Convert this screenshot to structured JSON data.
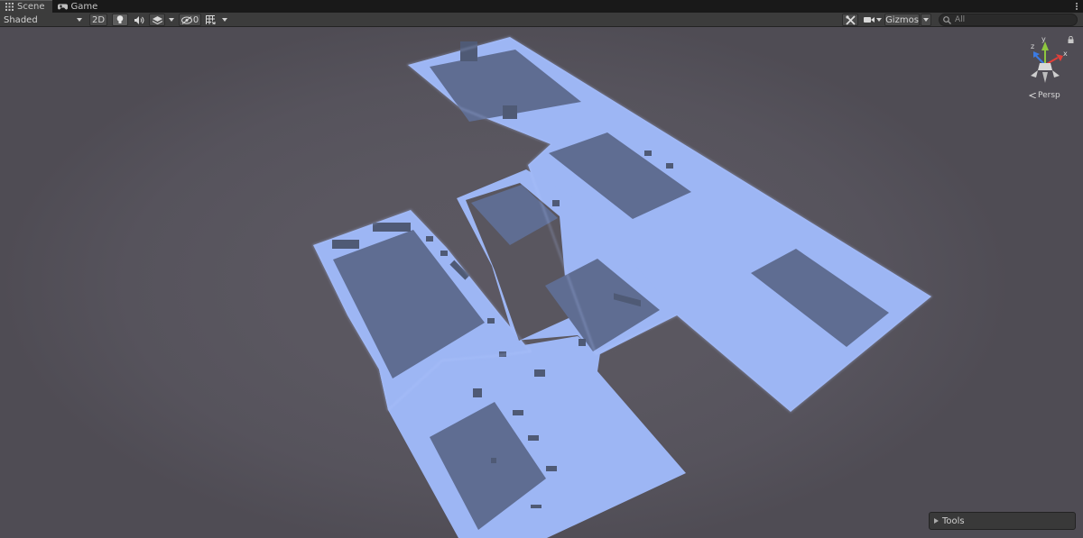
{
  "tabs": [
    {
      "label": "Scene",
      "icon": "grid-icon",
      "active": true
    },
    {
      "label": "Game",
      "icon": "gamepad-icon",
      "active": false
    }
  ],
  "toolbar": {
    "draw_mode": "Shaded",
    "mode_2d": "2D",
    "hidden_count": "0",
    "gizmos_label": "Gizmos",
    "search_placeholder": "All"
  },
  "gizmo": {
    "axis_y": "y",
    "axis_z": "z",
    "axis_x": "x",
    "projection": "Persp",
    "colors": {
      "x": "#e0403a",
      "y": "#8ec63f",
      "z": "#3b7be3"
    }
  },
  "overlay": {
    "tools_label": "Tools"
  },
  "scene_colors": {
    "floor": "#9fb8f6",
    "floor_dark": "#5f6e92",
    "prop": "#4f5a75",
    "background": "#5a5760"
  }
}
